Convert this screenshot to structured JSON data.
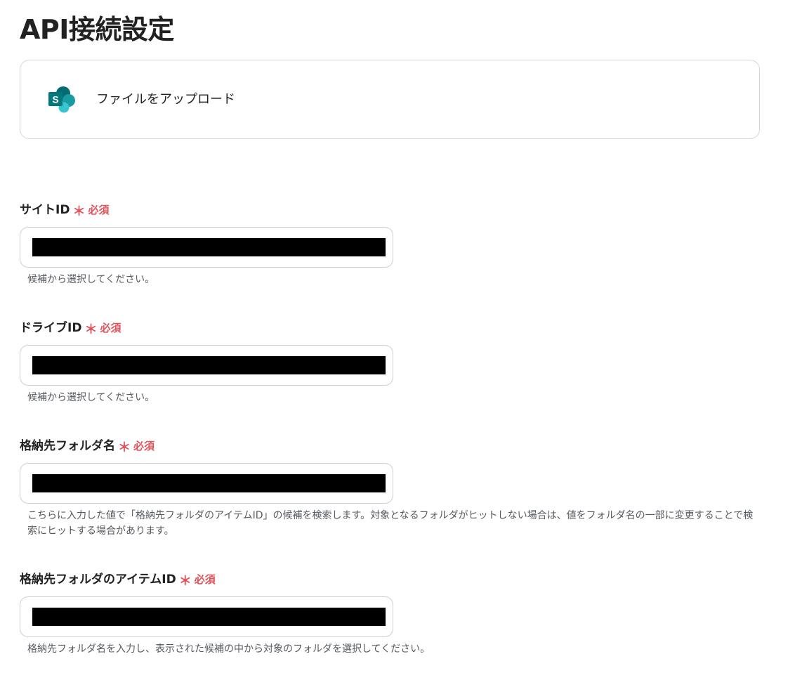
{
  "page": {
    "title": "API接続設定"
  },
  "action": {
    "icon": "sharepoint-icon",
    "label": "ファイルをアップロード"
  },
  "required_mark": "＊",
  "required_text": "必須",
  "fields": [
    {
      "label": "サイトID",
      "value": "",
      "help": "候補から選択してください。"
    },
    {
      "label": "ドライブID",
      "value": "",
      "help": "候補から選択してください。"
    },
    {
      "label": "格納先フォルダ名",
      "value": "",
      "help": "こちらに入力した値で「格納先フォルダのアイテムID」の候補を検索します。対象となるフォルダがヒットしない場合は、値をフォルダ名の一部に変更することで検索にヒットする場合があります。"
    },
    {
      "label": "格納先フォルダのアイテムID",
      "value": "",
      "help": "格納先フォルダ名を入力し、表示された候補の中から対象のフォルダを選択してください。"
    }
  ],
  "colors": {
    "required": "#e0535a",
    "border": "#cfcfcf",
    "help_text": "#555a60"
  }
}
